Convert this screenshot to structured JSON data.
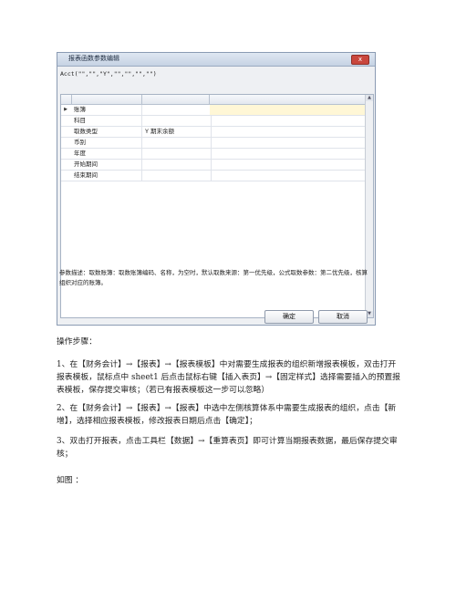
{
  "dialog": {
    "title": "报表函数参数编辑",
    "close_label": "x",
    "formula": "Acct(\"\",\"\",\"Y\",\"\",\"\",\"\",\"\")",
    "rows": [
      {
        "name": "账簿",
        "value": "",
        "marker": "▶"
      },
      {
        "name": "科目",
        "value": ""
      },
      {
        "name": "取数类型",
        "value": "Y      期末余额"
      },
      {
        "name": "币别",
        "value": ""
      },
      {
        "name": "年度",
        "value": ""
      },
      {
        "name": "开始期间",
        "value": ""
      },
      {
        "name": "结束期间",
        "value": ""
      }
    ],
    "description": "参数描述：取数账簿：取数账簿编码、名称，为空时，默认取数来源：第一优先级，公式取数参数：第二优先级，核算组织对应的账簿。",
    "ok_label": "确定",
    "cancel_label": "取消"
  },
  "doc": {
    "heading": "操作步骤：",
    "step1": "1、在【财务会计】→【报表】→【报表模板】中对需要生成报表的组织新增报表模板，双击打开报表模板，鼠标点中 sheet1 后点击鼠标右键【插入表页】→【固定样式】选择需要插入的预置报表模板，保存提交审核；（若已有报表模板这一步可以忽略）",
    "step2": "2、在【财务会计】→【报表】→【报表】中选中左侧核算体系中需要生成报表的组织，点击【新增】，选择相应报表模板，修改报表日期后点击【确定】；",
    "step3": "3、双击打开报表，点击工具栏【数据】→【重算表页】即可计算当期报表数据，最后保存提交审核；",
    "figure": "如图 ："
  }
}
